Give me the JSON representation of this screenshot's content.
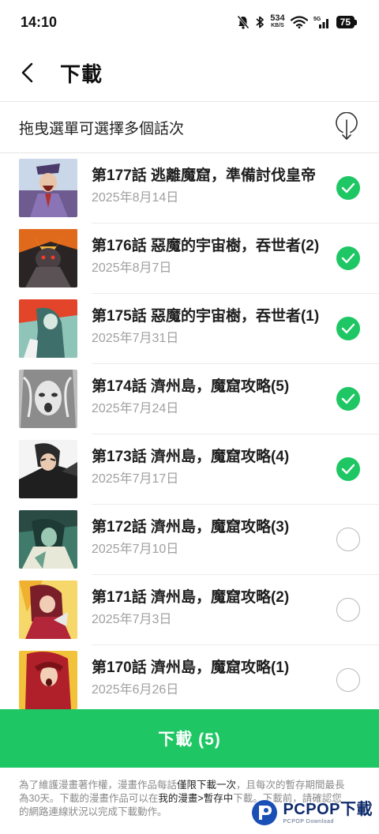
{
  "status_bar": {
    "time": "14:10",
    "net_speed_value": "534",
    "net_speed_unit": "KB/S",
    "signal_label": "5G",
    "battery": "75"
  },
  "header": {
    "title": "下載"
  },
  "hint": {
    "text": "拖曳選單可選擇多個話次"
  },
  "episodes": [
    {
      "title": "第177話 逃離魔窟，準備討伐皇帝",
      "date": "2025年8月14日",
      "selected": true
    },
    {
      "title": "第176話 惡魔的宇宙樹，吞世者(2)",
      "date": "2025年8月7日",
      "selected": true
    },
    {
      "title": "第175話 惡魔的宇宙樹，吞世者(1)",
      "date": "2025年7月31日",
      "selected": true
    },
    {
      "title": "第174話 濟州島，魔窟攻略(5)",
      "date": "2025年7月24日",
      "selected": true
    },
    {
      "title": "第173話 濟州島，魔窟攻略(4)",
      "date": "2025年7月17日",
      "selected": true
    },
    {
      "title": "第172話 濟州島，魔窟攻略(3)",
      "date": "2025年7月10日",
      "selected": false
    },
    {
      "title": "第171話 濟州島，魔窟攻略(2)",
      "date": "2025年7月3日",
      "selected": false
    },
    {
      "title": "第170話 濟州島，魔窟攻略(1)",
      "date": "2025年6月26日",
      "selected": false
    }
  ],
  "download_button": {
    "label": "下載 (5)"
  },
  "notice": {
    "part1": "為了維護漫畫著作權，漫畫作品每話",
    "highlight1": "僅限下載一次",
    "part2": "，且每次的暫存期間最長為30天。下載的漫畫作品可以在",
    "highlight2": "我的漫畫>暫存中",
    "part3": "下載。下載前，請確認您的網路連線狀況以完成下載動作。"
  },
  "watermark": {
    "main": "PCPOP下載",
    "sub": "PCPOP Download"
  },
  "colors": {
    "accent_green": "#1ec764",
    "date_gray": "#a0a0a0",
    "watermark_blue": "#0d2a6b"
  }
}
